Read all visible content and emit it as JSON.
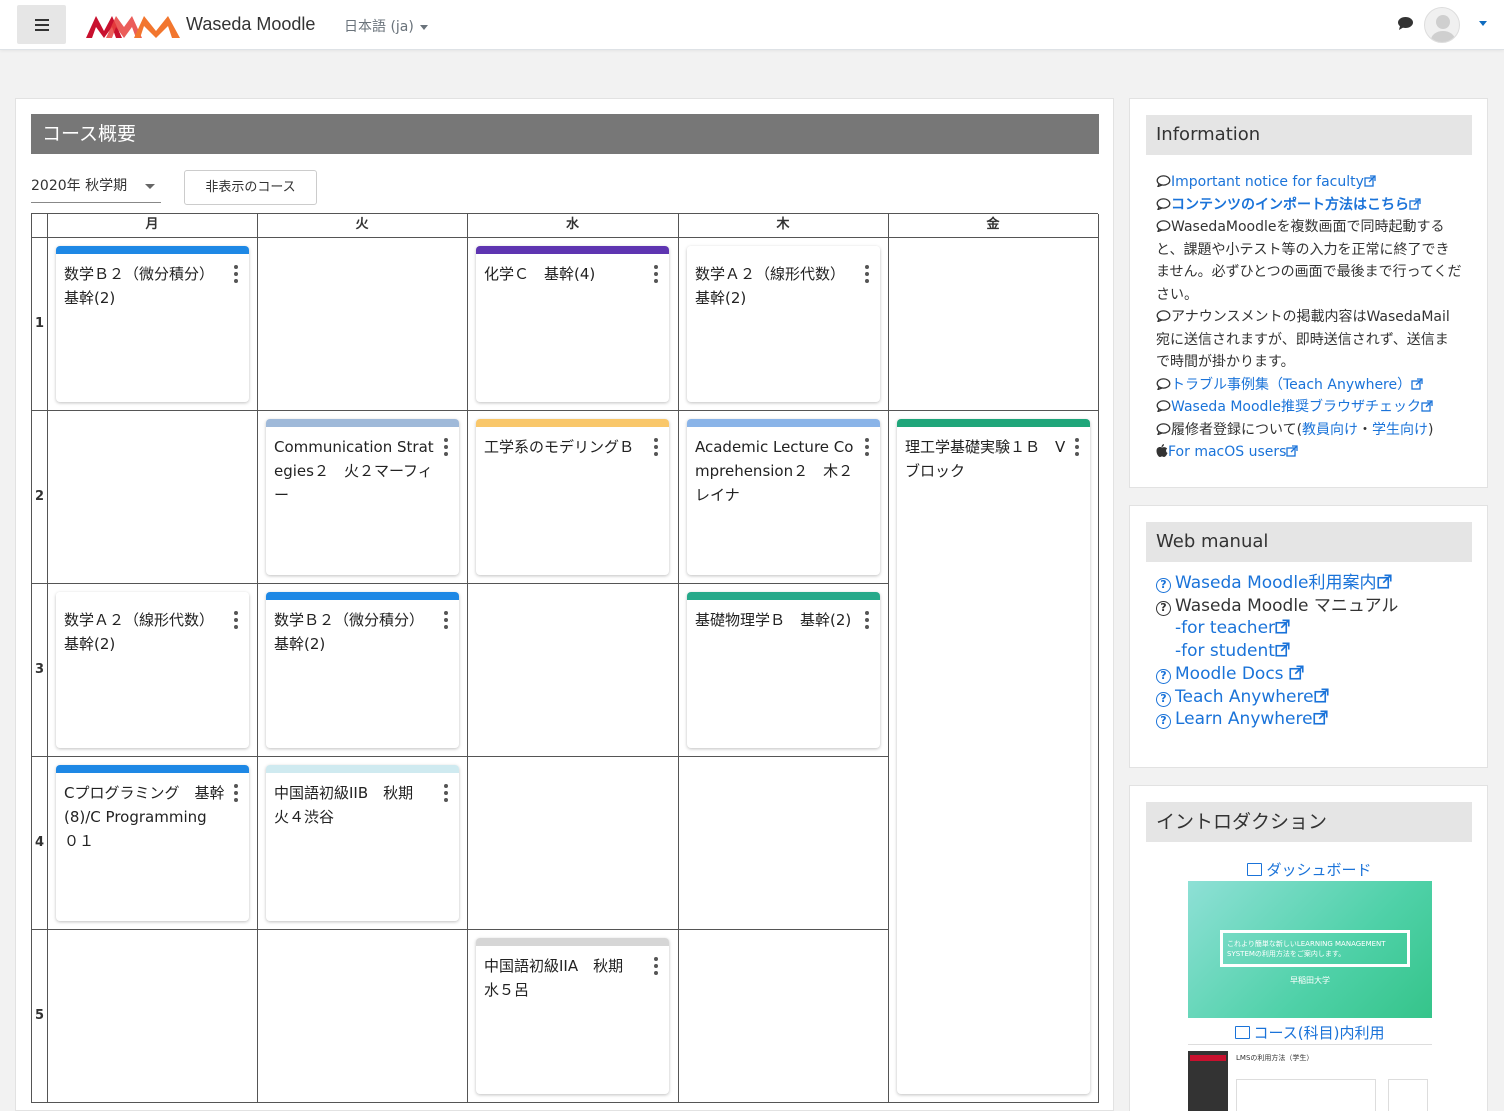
{
  "header": {
    "site_name": "Waseda Moodle",
    "language": "日本語 (ja)"
  },
  "main": {
    "title": "コース概要",
    "term": "2020年 秋学期",
    "hidden_courses_button": "非表示のコース",
    "days": [
      "月",
      "火",
      "水",
      "木",
      "金"
    ],
    "periods": [
      "1",
      "2",
      "3",
      "4",
      "5"
    ],
    "courses": [
      {
        "title": "数学Ｂ２（微分積分）　基幹(2)",
        "color": "#1e88e5"
      },
      {
        "title": "化学Ｃ　基幹(4)",
        "color": "#5e35b1"
      },
      {
        "title": "数学Ａ２（線形代数）　基幹(2)",
        "color": "#ffffff"
      },
      {
        "title": "Communication Strategies２　火２マーフィー",
        "color": "#9fb9d9"
      },
      {
        "title": "工学系のモデリングＢ",
        "color": "#f9c76a"
      },
      {
        "title": "Academic Lecture Comprehension２　木２レイナ",
        "color": "#8ab4e8"
      },
      {
        "title": "理工学基礎実験１Ｂ　Vブロック",
        "color": "#1fa67a"
      },
      {
        "title": "数学Ａ２（線形代数）　基幹(2)",
        "color": "#ffffff"
      },
      {
        "title": "数学Ｂ２（微分積分）　基幹(2)",
        "color": "#1e88e5"
      },
      {
        "title": "基礎物理学Ｂ　基幹(2)",
        "color": "#26a98a"
      },
      {
        "title": "Cプログラミング　基幹(8)/C Programming　０１",
        "color": "#1e88e5"
      },
      {
        "title": "中国語初級IIB　秋期　火４渋谷",
        "color": "#cfeaf0"
      },
      {
        "title": "中国語初級IIA　秋期　水５呂",
        "color": "#d6d6d6"
      }
    ]
  },
  "information": {
    "title": "Information",
    "important_notice": "Important notice for faculty",
    "import_method": "コンテンツのインポート方法はこちら",
    "warning": "WasedaMoodleを複数画面で同時起動すると、課題や小テスト等の入力を正常に終了できません。必ずひとつの画面で最後まで行ってください。",
    "announcement": "アナウンスメントの掲載内容はWasedaMail宛に送信されますが、即時送信されず、送信まで時間が掛かります。",
    "trouble_cases": "トラブル事例集（Teach Anywhere）",
    "browser_check": "Waseda Moodle推奨ブラウザチェック",
    "enrollment_prefix": "履修者登録について(",
    "enrollment_faculty": "教員向け",
    "enrollment_sep": "・",
    "enrollment_student": "学生向け",
    "enrollment_suffix": ")",
    "macos": "For macOS users"
  },
  "web_manual": {
    "title": "Web manual",
    "guide": "Waseda Moodle利用案内",
    "manual": "Waseda Moodle マニュアル",
    "for_teacher": "-for teacher",
    "for_student": "-for student",
    "moodle_docs": "Moodle Docs",
    "teach_anywhere": "Teach Anywhere",
    "learn_anywhere": "Learn Anywhere"
  },
  "introduction": {
    "title": "イントロダクション",
    "dashboard": "ダッシュボード",
    "thumb1_text": "これより簡単な新しいLEARNING MANAGEMENT SYSTEMの利用方法をご案内します。",
    "thumb1_sub": "早稲田大学",
    "course_use": "コース(科目)内利用",
    "thumb2_text": "LMSの利用方法（学生）"
  },
  "colors": {
    "accent": "#1a73d9",
    "header_bar": "#777777"
  }
}
